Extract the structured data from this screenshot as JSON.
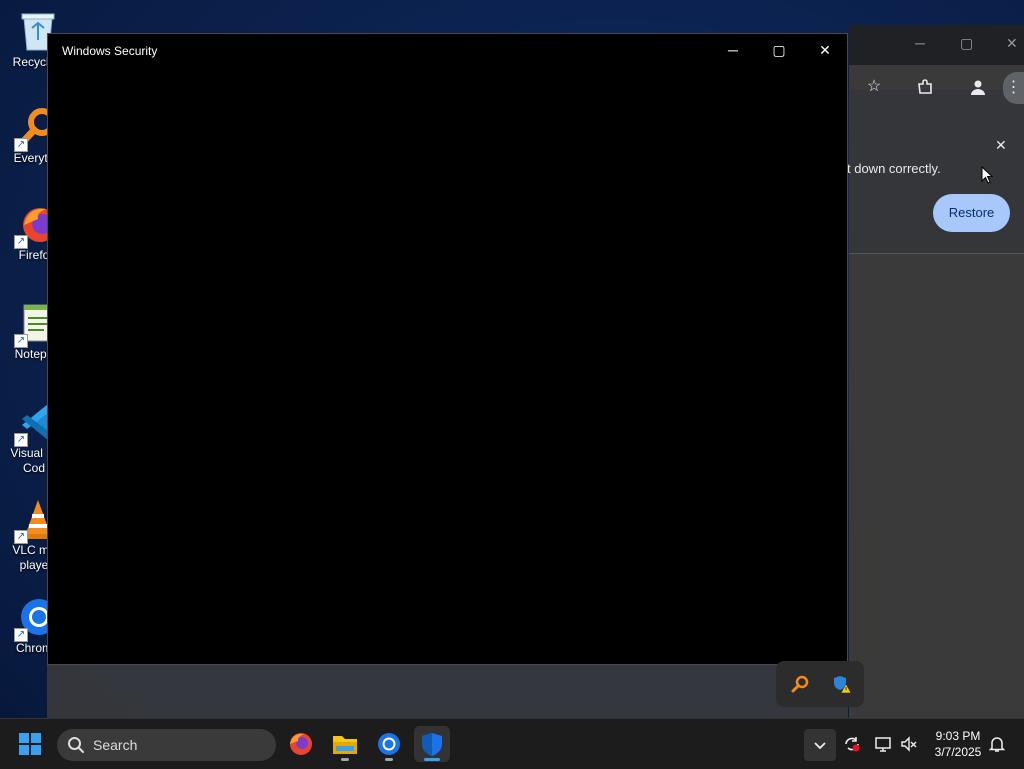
{
  "desktop": {
    "icons": [
      {
        "label": "Recycle"
      },
      {
        "label": "Everyth"
      },
      {
        "label": "Firefo"
      },
      {
        "label": "Notepa"
      },
      {
        "label": "Visual St\nCod"
      },
      {
        "label": "VLC me\nplaye"
      },
      {
        "label": "Chrom"
      }
    ]
  },
  "chrome": {
    "infobar_message": "t down correctly.",
    "restore_label": "Restore"
  },
  "security_window": {
    "title": "Windows Security"
  },
  "taskbar": {
    "search_label": "Search",
    "time": "9:03 PM",
    "date": "3/7/2025"
  },
  "colors": {
    "accent": "#3aa0f0",
    "restore_button": "#a8c7fa"
  }
}
